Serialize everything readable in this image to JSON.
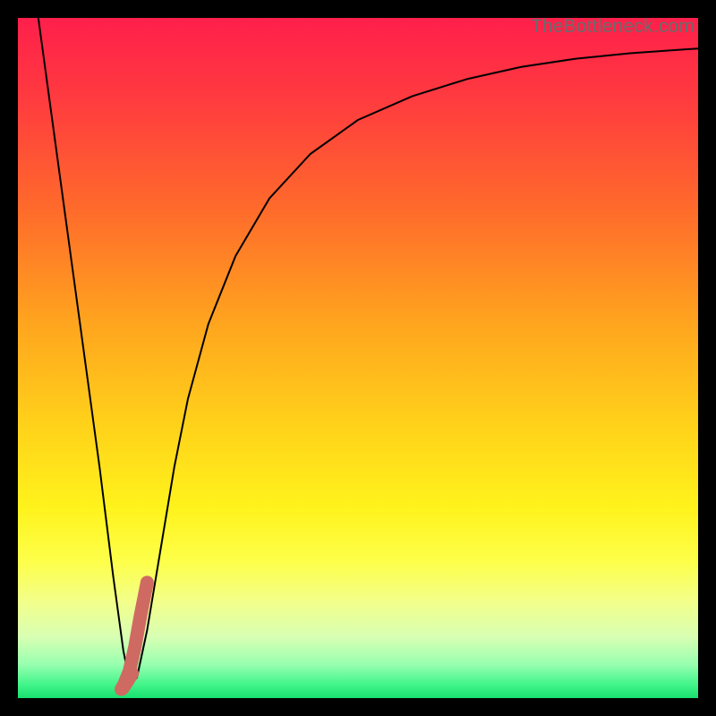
{
  "watermark": "TheBottleneck.com",
  "chart_data": {
    "type": "line",
    "title": "",
    "xlabel": "",
    "ylabel": "",
    "xlim": [
      0,
      100
    ],
    "ylim": [
      0,
      100
    ],
    "grid": false,
    "legend": false,
    "background_gradient": {
      "stops": [
        {
          "offset": 0.0,
          "color": "#ff1f4b"
        },
        {
          "offset": 0.12,
          "color": "#ff3b3f"
        },
        {
          "offset": 0.28,
          "color": "#ff6a2b"
        },
        {
          "offset": 0.45,
          "color": "#ffa51e"
        },
        {
          "offset": 0.6,
          "color": "#ffd21a"
        },
        {
          "offset": 0.72,
          "color": "#fff31c"
        },
        {
          "offset": 0.8,
          "color": "#fdff4a"
        },
        {
          "offset": 0.86,
          "color": "#f2ff8c"
        },
        {
          "offset": 0.91,
          "color": "#d8ffb3"
        },
        {
          "offset": 0.95,
          "color": "#99ffb0"
        },
        {
          "offset": 0.98,
          "color": "#42f58b"
        },
        {
          "offset": 1.0,
          "color": "#18e06e"
        }
      ]
    },
    "series": [
      {
        "name": "bottleneck-curve",
        "stroke": "#000000",
        "stroke_width": 2,
        "x": [
          3.0,
          6.0,
          9.0,
          12.0,
          14.0,
          15.5,
          16.5,
          17.5,
          19.0,
          21.0,
          23.0,
          25.0,
          28.0,
          32.0,
          37.0,
          43.0,
          50.0,
          58.0,
          66.0,
          74.0,
          82.0,
          90.0,
          97.0,
          100.0
        ],
        "y": [
          100.0,
          78.0,
          56.0,
          34.0,
          18.0,
          7.0,
          2.0,
          3.0,
          10.0,
          22.0,
          34.0,
          44.0,
          55.0,
          65.0,
          73.5,
          80.0,
          85.0,
          88.5,
          91.0,
          92.8,
          94.0,
          94.8,
          95.3,
          95.5
        ]
      },
      {
        "name": "marker-j",
        "stroke": "#cf6a62",
        "stroke_width": 15,
        "linecap": "round",
        "x": [
          19.0,
          18.0,
          17.2,
          16.4,
          15.6,
          15.2,
          15.4,
          16.0,
          16.8
        ],
        "y": [
          17.0,
          12.0,
          7.5,
          4.0,
          2.0,
          1.3,
          1.4,
          2.3,
          3.6
        ]
      }
    ]
  }
}
